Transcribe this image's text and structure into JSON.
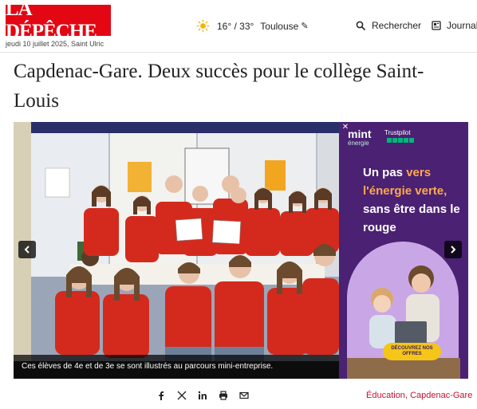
{
  "header": {
    "logo_text": "LA DÉPÊCHE",
    "dateline": "jeudi 10 juillet 2025, Saint Ulric",
    "weather": {
      "icon": "sun-icon",
      "temperature": "16° / 33°",
      "city": "Toulouse",
      "edit_icon": "pencil-icon"
    },
    "search_label": "Rechercher",
    "journal_label": "Journal"
  },
  "article": {
    "title": "Capdenac-Gare. Deux succès pour le collège Saint-Louis"
  },
  "carousel": {
    "caption": "Ces élèves de 4e et de 3e se sont illustrés au parcours mini-entreprise.",
    "prev_icon": "chevron-left-icon",
    "next_icon": "chevron-right-icon"
  },
  "ad": {
    "close_label": "✕",
    "brand": "mint",
    "brand_sub": "énergie",
    "trustpilot": "Trustpilot",
    "headline_start": "Un pas ",
    "headline_highlight": "vers l'énergie verte,",
    "headline_end": " sans être dans le rouge",
    "cta": "DÉCOUVREZ NOS OFFRES"
  },
  "share": {
    "icons": [
      "facebook-icon",
      "x-icon",
      "linkedin-icon",
      "print-icon",
      "email-icon"
    ]
  },
  "tags": {
    "first": "Éducation",
    "separator": ", ",
    "second": "Capdenac-Gare"
  },
  "colors": {
    "brand_red": "#e30613",
    "tag_red": "#c8102e",
    "ad_purple": "#4a2173",
    "ad_orange": "#ffa94d",
    "ad_yellow": "#f5c518",
    "shirt_red": "#d42a1e"
  }
}
